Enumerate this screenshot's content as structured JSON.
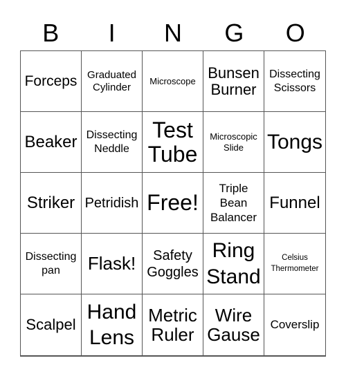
{
  "header": {
    "letters": [
      "B",
      "I",
      "N",
      "G",
      "O"
    ]
  },
  "cells": [
    "Forceps",
    "Graduated Cylinder",
    "Microscope",
    "Bunsen Burner",
    "Dissecting Scissors",
    "Beaker",
    "Dissecting Neddle",
    "Test Tube",
    "Microscopic Slide",
    "Tongs",
    "Striker",
    "Petridish",
    "Free!",
    "Triple Bean Balancer",
    "Funnel",
    "Dissecting pan",
    "Flask!",
    "Safety Goggles",
    "Ring Stand",
    "Celsius Thermometer",
    "Scalpel",
    "Hand Lens",
    "Metric Ruler",
    "Wire Gause",
    "Coverslip"
  ],
  "colors": {
    "grid_line": "#555555",
    "text": "#000000",
    "background": "#ffffff"
  }
}
